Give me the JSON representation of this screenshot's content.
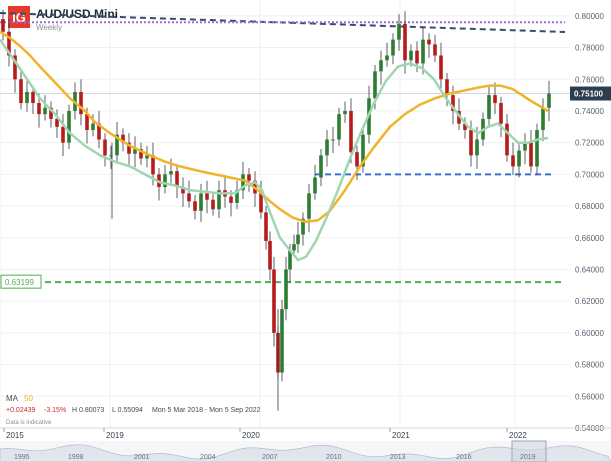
{
  "header": {
    "logo": "IG",
    "instrument": "AUD/USD Mini",
    "timeframe": "Weekly"
  },
  "legend": {
    "ma_label": "MA",
    "ma_period": "50",
    "change": "+0.02439",
    "change_pct": "-3.15%",
    "high": "H 0.80073",
    "low": "L 0.55094",
    "date_range": "Mon 5 Mar 2018 - Mon 5 Sep 2022",
    "disclaimer": "Data is indicative"
  },
  "colors": {
    "up_candle": "#2e7d32",
    "down_candle": "#b71c1c",
    "ma_long": "#f0b429",
    "ma_short": "#9fd6b0",
    "support_line": "#3a6fd8",
    "resistance_line": "#3b4a6b",
    "ceiling_line": "#a16bd8",
    "green_support": "#4caf50",
    "price_badge": "#2d3e50"
  },
  "chart_data": {
    "type": "candlestick",
    "y_axis": {
      "ticks": [
        "0.80000",
        "0.78000",
        "0.76000",
        "0.74000",
        "0.72000",
        "0.70000",
        "0.68000",
        "0.66000",
        "0.64000",
        "0.62000",
        "0.60000",
        "0.58000",
        "0.56000",
        "0.54000"
      ],
      "range": [
        0.54,
        0.81
      ],
      "current_price": "0.75100",
      "current_value": 0.751
    },
    "x_axis": {
      "labels": [
        "2015",
        "2019",
        "2020",
        "2021",
        "2022"
      ]
    },
    "navigator_labels": [
      "1995",
      "1998",
      "2001",
      "2004",
      "2007",
      "2010",
      "2013",
      "2016",
      "2019"
    ],
    "annotations": {
      "support_label": "0.63199",
      "support_value": 0.632,
      "horizontal_support": 0.7,
      "ceiling_value": 0.796
    },
    "series": [
      {
        "name": "MA 50",
        "points": [
          [
            0,
            0.79
          ],
          [
            10,
            0.786
          ],
          [
            20,
            0.781
          ],
          [
            30,
            0.775
          ],
          [
            40,
            0.768
          ],
          [
            55,
            0.758
          ],
          [
            70,
            0.748
          ],
          [
            85,
            0.74
          ],
          [
            95,
            0.733
          ],
          [
            110,
            0.726
          ],
          [
            130,
            0.718
          ],
          [
            150,
            0.712
          ],
          [
            165,
            0.708
          ],
          [
            180,
            0.705
          ],
          [
            200,
            0.702
          ],
          [
            215,
            0.7
          ],
          [
            230,
            0.698
          ],
          [
            245,
            0.696
          ],
          [
            258,
            0.69
          ],
          [
            270,
            0.683
          ],
          [
            280,
            0.678
          ],
          [
            292,
            0.673
          ],
          [
            305,
            0.67
          ],
          [
            318,
            0.671
          ],
          [
            330,
            0.677
          ],
          [
            345,
            0.69
          ],
          [
            360,
            0.705
          ],
          [
            375,
            0.718
          ],
          [
            390,
            0.73
          ],
          [
            405,
            0.738
          ],
          [
            420,
            0.744
          ],
          [
            435,
            0.748
          ],
          [
            450,
            0.751
          ],
          [
            465,
            0.753
          ],
          [
            480,
            0.755
          ],
          [
            490,
            0.756
          ],
          [
            500,
            0.756
          ],
          [
            512,
            0.754
          ],
          [
            522,
            0.75
          ],
          [
            532,
            0.746
          ],
          [
            540,
            0.743
          ],
          [
            548,
            0.74
          ]
        ]
      },
      {
        "name": "MA",
        "points": [
          [
            0,
            0.785
          ],
          [
            12,
            0.774
          ],
          [
            25,
            0.762
          ],
          [
            40,
            0.748
          ],
          [
            55,
            0.738
          ],
          [
            70,
            0.726
          ],
          [
            85,
            0.718
          ],
          [
            100,
            0.712
          ],
          [
            115,
            0.708
          ],
          [
            130,
            0.705
          ],
          [
            145,
            0.7
          ],
          [
            160,
            0.695
          ],
          [
            175,
            0.693
          ],
          [
            190,
            0.69
          ],
          [
            205,
            0.689
          ],
          [
            220,
            0.688
          ],
          [
            235,
            0.688
          ],
          [
            245,
            0.693
          ],
          [
            255,
            0.695
          ],
          [
            262,
            0.69
          ],
          [
            270,
            0.676
          ],
          [
            280,
            0.66
          ],
          [
            290,
            0.652
          ],
          [
            298,
            0.646
          ],
          [
            306,
            0.648
          ],
          [
            316,
            0.658
          ],
          [
            326,
            0.672
          ],
          [
            338,
            0.69
          ],
          [
            350,
            0.71
          ],
          [
            362,
            0.728
          ],
          [
            374,
            0.745
          ],
          [
            386,
            0.759
          ],
          [
            398,
            0.768
          ],
          [
            410,
            0.77
          ],
          [
            422,
            0.767
          ],
          [
            434,
            0.76
          ],
          [
            446,
            0.748
          ],
          [
            458,
            0.738
          ],
          [
            468,
            0.73
          ],
          [
            478,
            0.726
          ],
          [
            488,
            0.73
          ],
          [
            498,
            0.732
          ],
          [
            508,
            0.726
          ],
          [
            518,
            0.72
          ],
          [
            528,
            0.72
          ],
          [
            538,
            0.722
          ],
          [
            548,
            0.723
          ]
        ]
      },
      {
        "name": "price",
        "points": [
          [
            0,
            0.798
          ],
          [
            6,
            0.79
          ],
          [
            12,
            0.775
          ],
          [
            18,
            0.76
          ],
          [
            24,
            0.745
          ],
          [
            30,
            0.752
          ],
          [
            36,
            0.745
          ],
          [
            42,
            0.738
          ],
          [
            48,
            0.742
          ],
          [
            54,
            0.735
          ],
          [
            60,
            0.73
          ],
          [
            66,
            0.72
          ],
          [
            72,
            0.74
          ],
          [
            78,
            0.752
          ],
          [
            84,
            0.738
          ],
          [
            90,
            0.728
          ],
          [
            96,
            0.732
          ],
          [
            102,
            0.722
          ],
          [
            108,
            0.712
          ],
          [
            114,
            0.712
          ],
          [
            120,
            0.725
          ],
          [
            126,
            0.72
          ],
          [
            132,
            0.713
          ],
          [
            138,
            0.716
          ],
          [
            144,
            0.71
          ],
          [
            150,
            0.712
          ],
          [
            156,
            0.7
          ],
          [
            162,
            0.692
          ],
          [
            168,
            0.7
          ],
          [
            174,
            0.702
          ],
          [
            180,
            0.692
          ],
          [
            186,
            0.688
          ],
          [
            192,
            0.683
          ],
          [
            198,
            0.677
          ],
          [
            204,
            0.688
          ],
          [
            210,
            0.684
          ],
          [
            216,
            0.678
          ],
          [
            222,
            0.69
          ],
          [
            228,
            0.686
          ],
          [
            234,
            0.682
          ],
          [
            240,
            0.69
          ],
          [
            246,
            0.7
          ],
          [
            252,
            0.696
          ],
          [
            258,
            0.688
          ],
          [
            264,
            0.676
          ],
          [
            268,
            0.658
          ],
          [
            272,
            0.64
          ],
          [
            276,
            0.6
          ],
          [
            280,
            0.575
          ],
          [
            284,
            0.615
          ],
          [
            288,
            0.64
          ],
          [
            292,
            0.652
          ],
          [
            296,
            0.656
          ],
          [
            300,
            0.662
          ],
          [
            306,
            0.672
          ],
          [
            312,
            0.688
          ],
          [
            318,
            0.698
          ],
          [
            324,
            0.712
          ],
          [
            330,
            0.722
          ],
          [
            336,
            0.722
          ],
          [
            342,
            0.738
          ],
          [
            348,
            0.74
          ],
          [
            354,
            0.714
          ],
          [
            360,
            0.705
          ],
          [
            366,
            0.725
          ],
          [
            372,
            0.748
          ],
          [
            378,
            0.765
          ],
          [
            384,
            0.772
          ],
          [
            390,
            0.775
          ],
          [
            396,
            0.785
          ],
          [
            402,
            0.795
          ],
          [
            408,
            0.772
          ],
          [
            414,
            0.778
          ],
          [
            420,
            0.77
          ],
          [
            426,
            0.785
          ],
          [
            432,
            0.782
          ],
          [
            438,
            0.775
          ],
          [
            444,
            0.76
          ],
          [
            450,
            0.75
          ],
          [
            456,
            0.74
          ],
          [
            462,
            0.732
          ],
          [
            468,
            0.728
          ],
          [
            474,
            0.712
          ],
          [
            480,
            0.722
          ],
          [
            486,
            0.735
          ],
          [
            492,
            0.75
          ],
          [
            498,
            0.745
          ],
          [
            504,
            0.732
          ],
          [
            510,
            0.712
          ],
          [
            516,
            0.705
          ],
          [
            522,
            0.715
          ],
          [
            528,
            0.72
          ],
          [
            534,
            0.705
          ],
          [
            540,
            0.728
          ],
          [
            546,
            0.742
          ],
          [
            552,
            0.751
          ]
        ]
      }
    ]
  }
}
